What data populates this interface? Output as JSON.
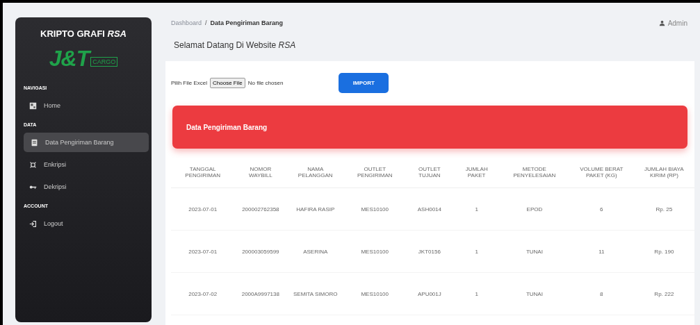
{
  "sidebar": {
    "brand": "KRIPTO GRAFI *RSA*",
    "logo": {
      "main": "J&T",
      "sub": "CARGO"
    },
    "sections": [
      {
        "title": "NAVIGASI",
        "items": [
          {
            "label": "Home",
            "selected": false
          }
        ]
      },
      {
        "title": "DATA",
        "items": [
          {
            "label": "Data Pengiriman Barang",
            "selected": true
          },
          {
            "label": "Enkripsi",
            "selected": false
          },
          {
            "label": "Dekripsi",
            "selected": false
          }
        ]
      },
      {
        "title": "ACCOUNT",
        "items": [
          {
            "label": "Logout",
            "selected": false
          }
        ]
      }
    ]
  },
  "breadcrumb_separator": "/",
  "breadcrumb": [
    {
      "label": "Dashboard",
      "current": false
    },
    {
      "label": "Data Pengiriman Barang",
      "current": true
    }
  ],
  "user": "Admin",
  "welcome": "Selamat Datang Di Website *RSA*",
  "upload": {
    "label": "Pilih File Excel",
    "button": "Choose File",
    "status": "No file chosen",
    "submit": "IMPORT"
  },
  "panel_title": "Data Pengiriman Barang",
  "table": {
    "columns": [
      "TANGGAL PENGIRIMAN",
      "NOMOR WAYBILL",
      "NAMA PELANGGAN",
      "OUTLET PENGIRIMAN",
      "OUTLET TUJUAN",
      "JUMLAH PAKET",
      "METODE PENYELESAIAN",
      "VOLUME BERAT PAKET (KG)",
      "JUMLAH BIAYA KIRIM (RP)"
    ],
    "rows": [
      [
        "2023-07-01",
        "200002762358",
        "HAFIRA RASIP",
        "MES10100",
        "ASH0014",
        "1",
        "EPOD",
        "6",
        "Rp. 25"
      ],
      [
        "2023-07-01",
        "200003059599",
        "ASERINA",
        "MES10100",
        "JKT0156",
        "1",
        "TUNAI",
        "11",
        "Rp. 190"
      ],
      [
        "2023-07-02",
        "2000A9997138",
        "SEMITA SIMORO",
        "MES10100",
        "APU001J",
        "1",
        "TUNAI",
        "8",
        "Rp. 222"
      ]
    ]
  }
}
